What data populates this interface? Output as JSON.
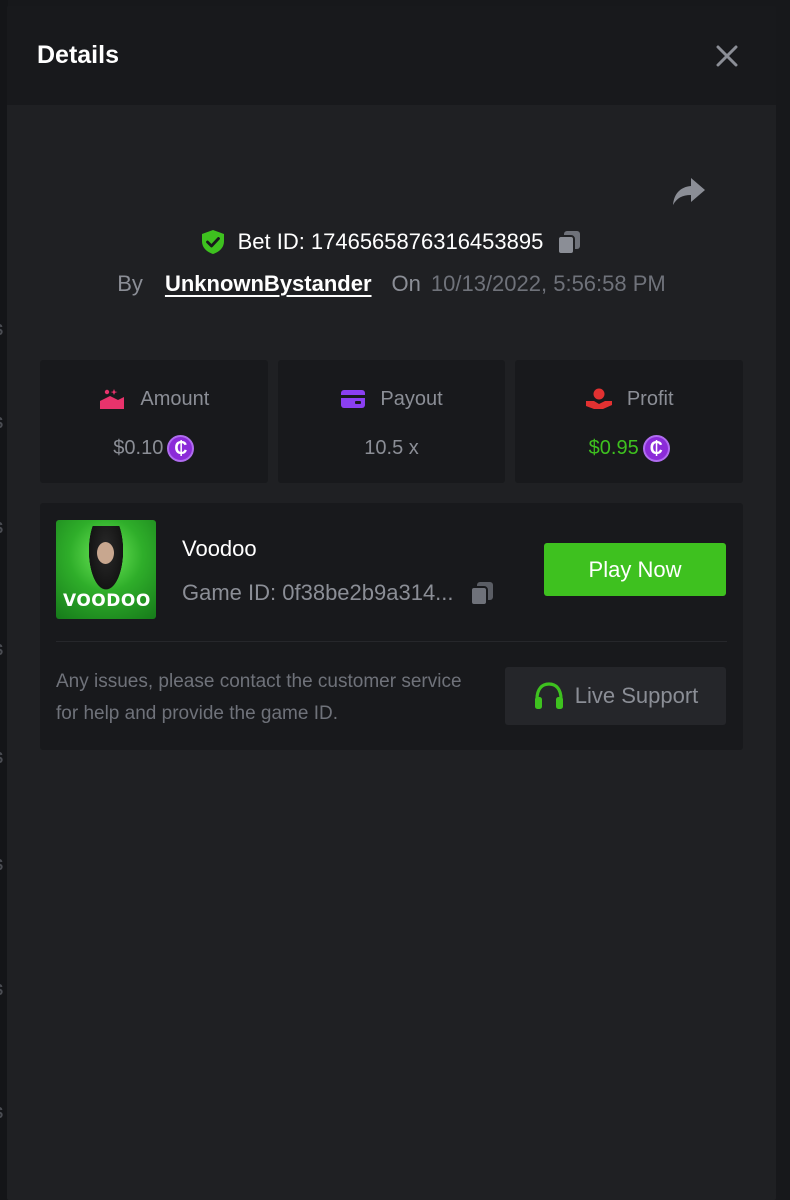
{
  "modal": {
    "title": "Details"
  },
  "bet": {
    "label": "Bet ID:",
    "id": "1746565876316453895",
    "by_label": "By",
    "user": "UnknownBystander",
    "on_label": "On",
    "datetime": "10/13/2022, 5:56:58 PM"
  },
  "stats": [
    {
      "label": "Amount",
      "value": "$0.10",
      "icon": "amount-icon",
      "color": "#e8336c",
      "coin": true
    },
    {
      "label": "Payout",
      "value": "10.5 x",
      "icon": "card-icon",
      "color": "#8a3ff0",
      "coin": false
    },
    {
      "label": "Profit",
      "value": "$0.95",
      "icon": "profit-icon",
      "color": "#e23131",
      "coin": true
    }
  ],
  "coin_symbol": "₵",
  "game": {
    "name": "Voodoo",
    "id_label": "Game ID: 0f38be2b9a314...",
    "thumb_title": "VOODOO",
    "play_label": "Play Now"
  },
  "support": {
    "help_text": "Any issues, please contact the customer service for help and provide the game ID.",
    "button_label": "Live Support"
  },
  "colors": {
    "accent_green": "#3ec11f",
    "panel": "#18191c",
    "background": "#1f2023"
  }
}
